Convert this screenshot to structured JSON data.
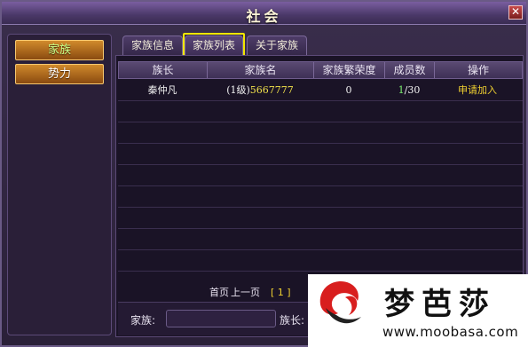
{
  "window": {
    "title": "社会",
    "close_glyph": "✕"
  },
  "side_nav": {
    "items": [
      {
        "label": "家族",
        "active": true
      },
      {
        "label": "势力",
        "active": false
      }
    ]
  },
  "tabs": [
    {
      "label": "家族信息",
      "selected": false
    },
    {
      "label": "家族列表",
      "selected": true
    },
    {
      "label": "关于家族",
      "selected": false
    }
  ],
  "table": {
    "headers": [
      "族长",
      "家族名",
      "家族繁荣度",
      "成员数",
      "操作"
    ],
    "rows": [
      {
        "leader": "秦仲凡",
        "name_level": "(1级)",
        "name": "5667777",
        "prosperity": "0",
        "members_current": "1",
        "members_max": "/30",
        "action": "申请加入"
      }
    ]
  },
  "pager": {
    "first": "首页",
    "prev": "上一页",
    "current": "[ 1 ]"
  },
  "search": {
    "family_label": "家族:",
    "leader_label": "族长:"
  },
  "watermark": {
    "name": "梦芭莎",
    "url": "www.moobasa.com"
  },
  "colors": {
    "highlight": "#f2e600",
    "button_orange": "#d08a2c",
    "gold_text": "#f0d030",
    "green_text": "#7cf070"
  }
}
